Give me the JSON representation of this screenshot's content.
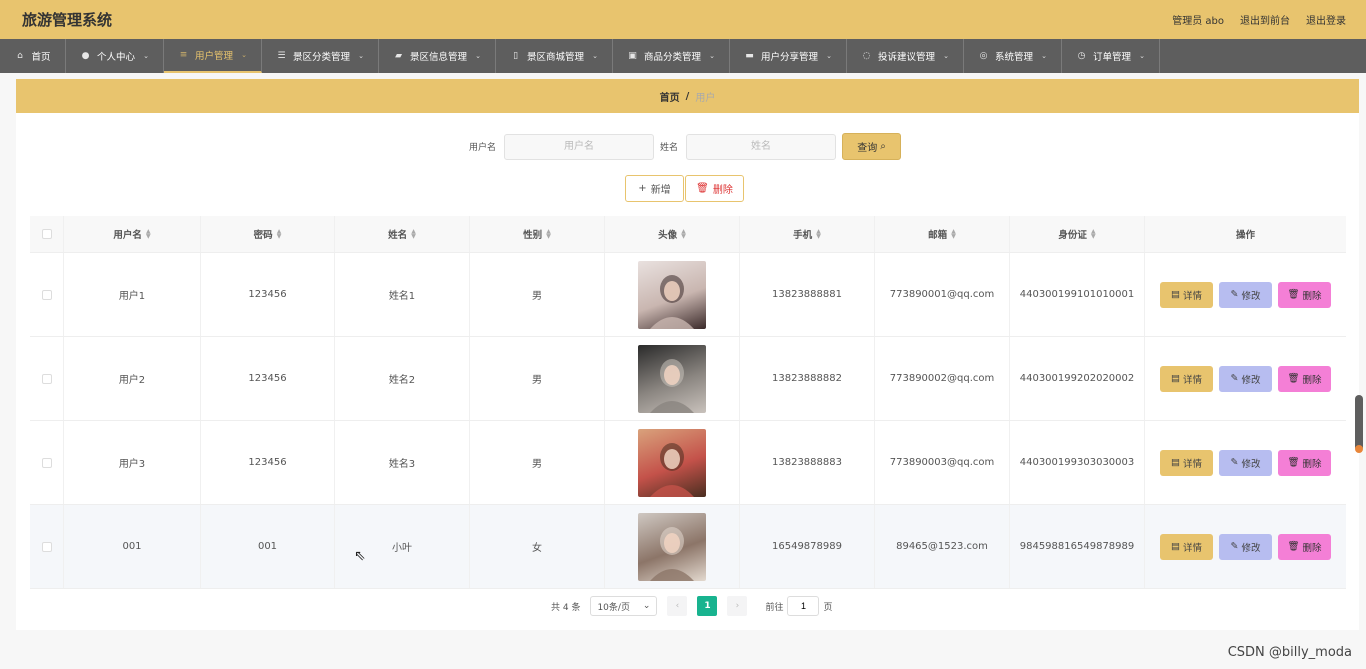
{
  "app": {
    "title": "旅游管理系统"
  },
  "header": {
    "user": "管理员 abo",
    "to_front": "退出到前台",
    "logout": "退出登录"
  },
  "nav": [
    {
      "label": "首页",
      "icon": "home-icon",
      "glyph": "⌂",
      "width": 66,
      "chevron": false
    },
    {
      "label": "个人中心",
      "icon": "user-icon",
      "glyph": "●",
      "width": 98,
      "chevron": true
    },
    {
      "label": "用户管理",
      "icon": "list-icon",
      "glyph": "≡",
      "width": 98,
      "chevron": true,
      "active": true
    },
    {
      "label": "景区分类管理",
      "icon": "sliders-icon",
      "glyph": "☰",
      "width": 117,
      "chevron": true
    },
    {
      "label": "景区信息管理",
      "icon": "briefcase-icon",
      "glyph": "▰",
      "width": 117,
      "chevron": true
    },
    {
      "label": "景区商城管理",
      "icon": "mic-icon",
      "glyph": "▯",
      "width": 117,
      "chevron": true
    },
    {
      "label": "商品分类管理",
      "icon": "trash-icon",
      "glyph": "▣",
      "width": 117,
      "chevron": true
    },
    {
      "label": "用户分享管理",
      "icon": "suitcase-icon",
      "glyph": "▬",
      "width": 117,
      "chevron": true
    },
    {
      "label": "投诉建议管理",
      "icon": "spinner-icon",
      "glyph": "◌",
      "width": 117,
      "chevron": true
    },
    {
      "label": "系统管理",
      "icon": "compass-icon",
      "glyph": "◎",
      "width": 98,
      "chevron": true
    },
    {
      "label": "订单管理",
      "icon": "clock-icon",
      "glyph": "◷",
      "width": 98,
      "chevron": true
    }
  ],
  "breadcrumb": {
    "home": "首页",
    "sep": "/",
    "current": "用户"
  },
  "search": {
    "username_label": "用户名",
    "username_placeholder": "用户名",
    "name_label": "姓名",
    "name_placeholder": "姓名",
    "query": "查询"
  },
  "actions": {
    "add": "新增",
    "delete": "删除"
  },
  "table": {
    "headers": [
      "用户名",
      "密码",
      "姓名",
      "性别",
      "头像",
      "手机",
      "邮箱",
      "身份证",
      "操作"
    ],
    "rows": [
      {
        "username": "用户1",
        "password": "123456",
        "name": "姓名1",
        "gender": "男",
        "phone": "13823888881",
        "email": "773890001@qq.com",
        "idcard": "440300199101010001",
        "avatar_colors": [
          "#e9e1df",
          "#c9b6b0",
          "#3b2a2a"
        ]
      },
      {
        "username": "用户2",
        "password": "123456",
        "name": "姓名2",
        "gender": "男",
        "phone": "13823888882",
        "email": "773890002@qq.com",
        "idcard": "440300199202020002",
        "avatar_colors": [
          "#2a2a2a",
          "#8a8580",
          "#c9c2bc"
        ]
      },
      {
        "username": "用户3",
        "password": "123456",
        "name": "姓名3",
        "gender": "男",
        "phone": "13823888883",
        "email": "773890003@qq.com",
        "idcard": "440300199303030003",
        "avatar_colors": [
          "#d9a27c",
          "#c4524a",
          "#4a2e20"
        ]
      },
      {
        "username": "001",
        "password": "001",
        "name": "小叶",
        "gender": "女",
        "phone": "16549878989",
        "email": "89465@1523.com",
        "idcard": "984598816549878989",
        "avatar_colors": [
          "#cfc8c2",
          "#8c7568",
          "#e3d9cf"
        ]
      }
    ],
    "row_buttons": {
      "detail": "详情",
      "edit": "修改",
      "remove": "删除"
    }
  },
  "pager": {
    "total": "共 4 条",
    "size": "10条/页",
    "page": "1",
    "goto": "前往",
    "goto_value": "1",
    "page_unit": "页"
  },
  "watermark": "CSDN @billy_moda"
}
